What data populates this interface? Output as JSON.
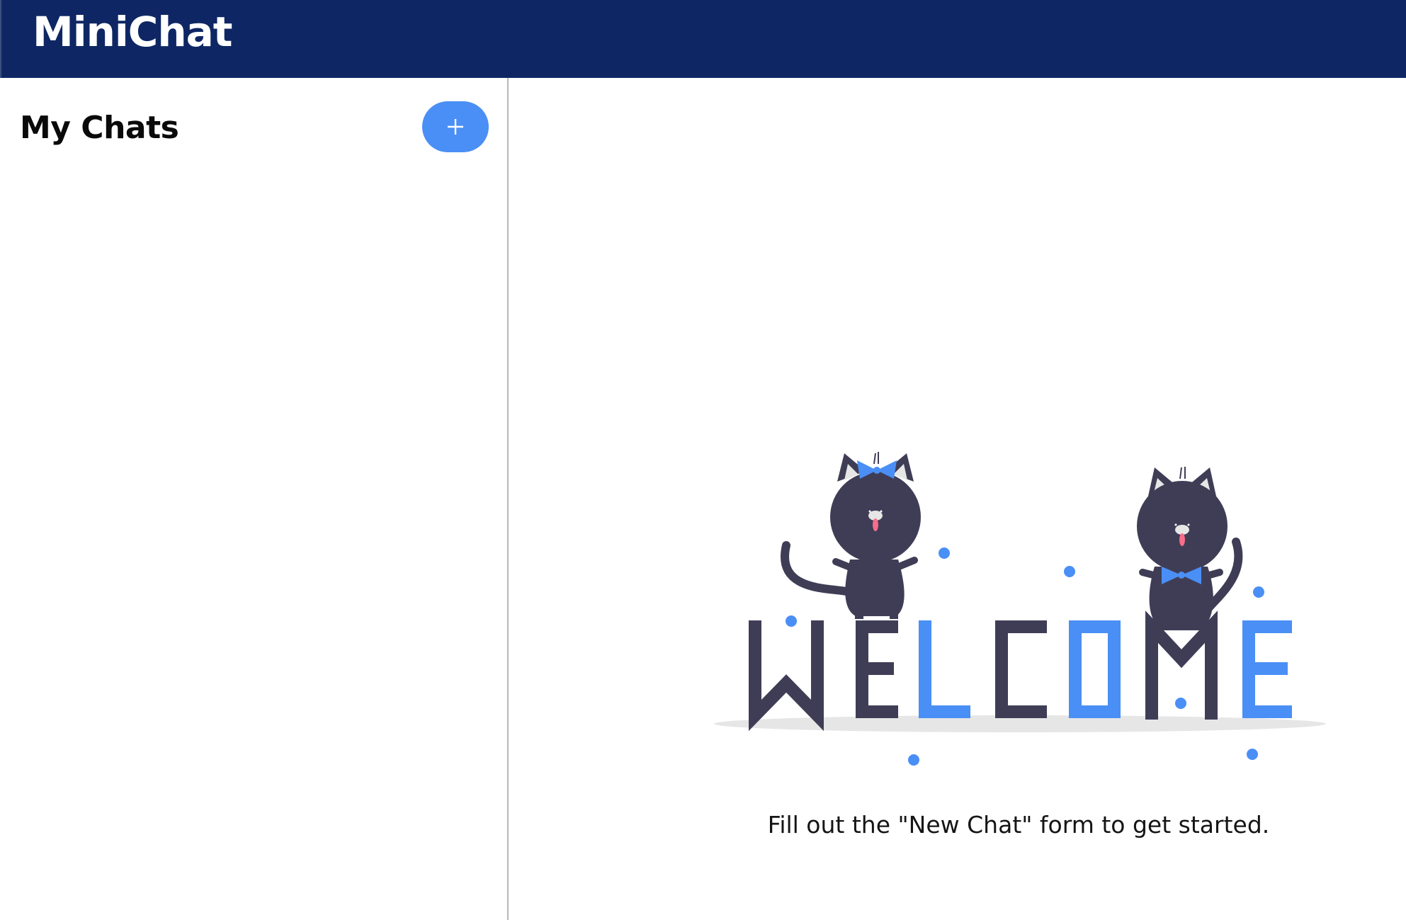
{
  "header": {
    "app_title": "MiniChat"
  },
  "sidebar": {
    "title": "My Chats",
    "new_chat_icon": "plus-icon"
  },
  "main": {
    "illustration_word": "WELCOME",
    "empty_state_message": "Fill out the \"New Chat\" form to get started."
  },
  "colors": {
    "header_bg": "#0e2764",
    "accent": "#4a8ff5",
    "cat": "#3f3d56"
  }
}
